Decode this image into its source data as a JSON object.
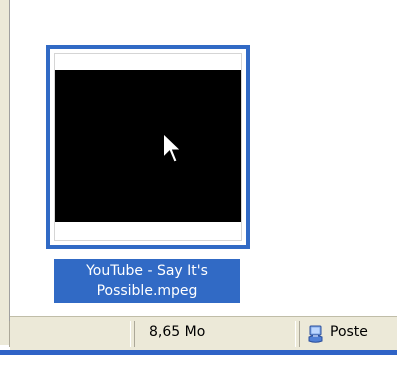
{
  "file": {
    "name": "YouTube - Say It's Possible.mpeg",
    "label_line1": "YouTube - Say It's",
    "label_line2": "Possible.mpeg",
    "selected": true
  },
  "status_bar": {
    "size": "8,65 Mo",
    "zone_label": "Poste",
    "zone_icon": "computer-icon"
  },
  "colors": {
    "selection": "#316ac5",
    "statusbar_bg": "#ece9d8",
    "video": "#000000"
  }
}
